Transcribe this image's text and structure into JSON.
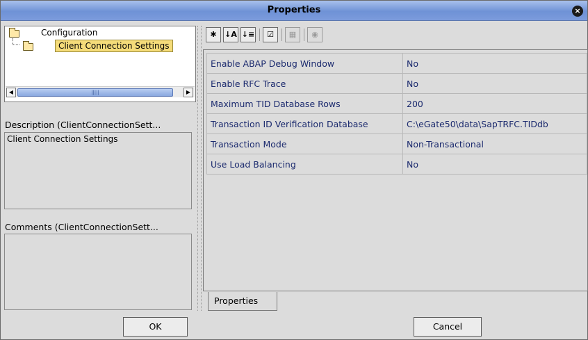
{
  "window": {
    "title": "Properties",
    "close_glyph": "×"
  },
  "tree": {
    "root_label": "Configuration",
    "child_label": "Client Connection Settings",
    "scroll_grip": "|||||",
    "left_arrow": "◀",
    "right_arrow": "▶"
  },
  "description": {
    "label": "Description (ClientConnectionSett...",
    "text": "Client Connection Settings"
  },
  "comments": {
    "label": "Comments (ClientConnectionSett...",
    "text": ""
  },
  "toolbar": {
    "buttons": [
      {
        "icon": "pin-icon",
        "glyph": "✱"
      },
      {
        "icon": "sort-az-icon",
        "glyph": "↓A"
      },
      {
        "icon": "sort-category-icon",
        "glyph": "↓≡"
      },
      {
        "icon": "checklist-icon",
        "glyph": "☑"
      },
      {
        "icon": "grid-icon",
        "glyph": "▦"
      },
      {
        "icon": "help-circle-icon",
        "glyph": "◉"
      }
    ]
  },
  "properties": [
    {
      "name": "Enable ABAP Debug Window",
      "value": "No"
    },
    {
      "name": "Enable RFC Trace",
      "value": "No"
    },
    {
      "name": "Maximum TID Database Rows",
      "value": "200"
    },
    {
      "name": "Transaction ID Verification Database",
      "value": "C:\\eGate50\\data\\SapTRFC.TIDdb"
    },
    {
      "name": "Transaction Mode",
      "value": "Non-Transactional"
    },
    {
      "name": "Use Load Balancing",
      "value": "No"
    }
  ],
  "tab_label": "Properties",
  "ok_label": "OK",
  "cancel_label": "Cancel"
}
